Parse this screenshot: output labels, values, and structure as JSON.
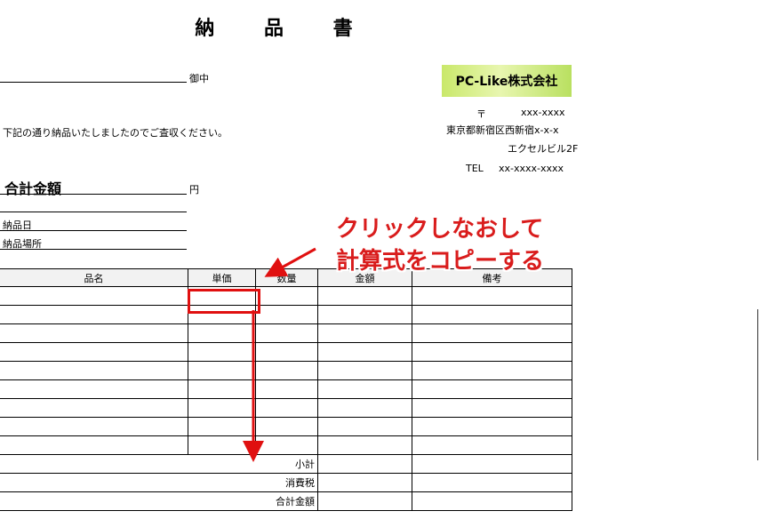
{
  "document": {
    "title": "納 品 書",
    "recipient_suffix": "御中",
    "greeting": "下記の通り納品いたしましたのでご査収ください。",
    "total_label": "合計金額",
    "total_unit": "円",
    "delivery_date_label": "納品日",
    "delivery_place_label": "納品場所"
  },
  "company": {
    "name": "PC-Like株式会社",
    "postal_mark": "〒",
    "postal_code": "xxx-xxxx",
    "address_line1": "東京都新宿区西新宿x-x-x",
    "address_line2": "エクセルビル2F",
    "tel_label": "TEL",
    "tel_number": "xx-xxxx-xxxx",
    "logo_color": "#c9e86a"
  },
  "table": {
    "headers": [
      "品名",
      "単価",
      "数量",
      "金額",
      "備考"
    ],
    "empty_rows": 9,
    "subtotal_label": "小計",
    "tax_label": "消費税",
    "grand_total_label": "合計金額"
  },
  "annotation": {
    "line1": "クリックしなおして",
    "line2": "計算式をコピーする",
    "color": "#d91c1c"
  }
}
